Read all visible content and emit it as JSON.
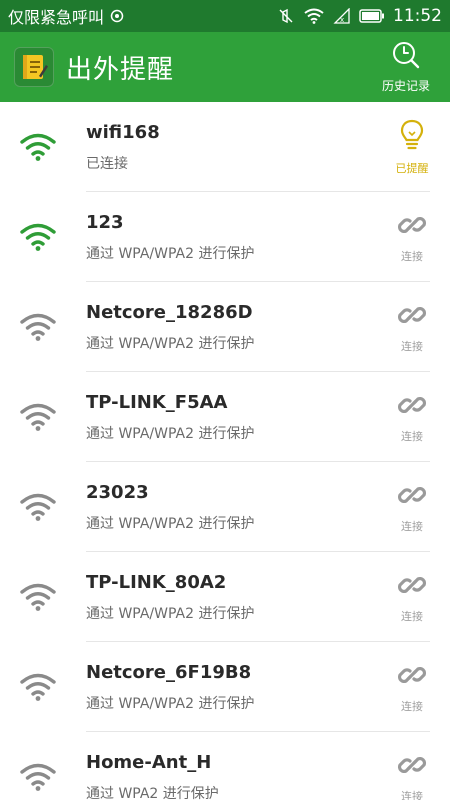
{
  "status_bar": {
    "left_text": "仅限紧急呼叫",
    "time": "11:52"
  },
  "app_bar": {
    "title": "出外提醒",
    "history_label": "历史记录",
    "icon": "notebook-icon"
  },
  "colors": {
    "primary_green": "#2fa13a",
    "status_green": "#1f7a2e",
    "wifi_connected": "#2f9d37",
    "wifi_idle": "#8a8a8a",
    "reminder_yellow": "#d4b10c"
  },
  "networks": [
    {
      "ssid": "wifi168",
      "status": "已连接",
      "action": "已提醒",
      "connected": true
    },
    {
      "ssid": "123",
      "status": "通过 WPA/WPA2 进行保护",
      "action": "连接",
      "connected": false,
      "strong": true
    },
    {
      "ssid": "Netcore_18286D",
      "status": "通过 WPA/WPA2 进行保护",
      "action": "连接",
      "connected": false
    },
    {
      "ssid": "TP-LINK_F5AA",
      "status": "通过 WPA/WPA2 进行保护",
      "action": "连接",
      "connected": false
    },
    {
      "ssid": "23023",
      "status": "通过 WPA/WPA2 进行保护",
      "action": "连接",
      "connected": false
    },
    {
      "ssid": "TP-LINK_80A2",
      "status": "通过 WPA/WPA2 进行保护",
      "action": "连接",
      "connected": false
    },
    {
      "ssid": "Netcore_6F19B8",
      "status": "通过 WPA/WPA2 进行保护",
      "action": "连接",
      "connected": false
    },
    {
      "ssid": "Home-Ant_H",
      "status": "通过 WPA2 进行保护",
      "action": "连接",
      "connected": false
    }
  ]
}
